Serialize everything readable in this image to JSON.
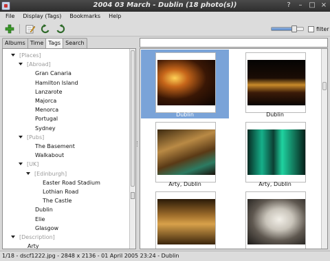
{
  "window": {
    "title": "2004 03 March - Dublin (18 photo(s))",
    "controls": [
      "?",
      "–",
      "□",
      "×"
    ]
  },
  "menu": [
    "File",
    "Display (Tags)",
    "Bookmarks",
    "Help"
  ],
  "toolbar": {
    "add_icon": "plus-icon",
    "edit_icon": "edit-icon",
    "rotate_left_icon": "rotate-left-icon",
    "rotate_right_icon": "rotate-right-icon",
    "zoom_level": 0.72,
    "filter_label": "filter",
    "filter_checked": false
  },
  "tabs": [
    "Albums",
    "Time",
    "Tags",
    "Search"
  ],
  "active_tab": "Tags",
  "tree": [
    {
      "label": "[Places]",
      "depth": 0,
      "expanded": true,
      "dim": true
    },
    {
      "label": "[Abroad]",
      "depth": 1,
      "expanded": true,
      "dim": true
    },
    {
      "label": "Gran Canaria",
      "depth": 2
    },
    {
      "label": "Hamilton Island",
      "depth": 2
    },
    {
      "label": "Lanzarote",
      "depth": 2
    },
    {
      "label": "Majorca",
      "depth": 2
    },
    {
      "label": "Menorca",
      "depth": 2
    },
    {
      "label": "Portugal",
      "depth": 2
    },
    {
      "label": "Sydney",
      "depth": 2
    },
    {
      "label": "[Pubs]",
      "depth": 1,
      "expanded": true,
      "dim": true
    },
    {
      "label": "The Basement",
      "depth": 2
    },
    {
      "label": "Walkabout",
      "depth": 2
    },
    {
      "label": "[UK]",
      "depth": 1,
      "expanded": true,
      "dim": true
    },
    {
      "label": "[Edinburgh]",
      "depth": 2,
      "expanded": true,
      "dim": true
    },
    {
      "label": "Easter Road Stadium",
      "depth": 3
    },
    {
      "label": "Lothian Road",
      "depth": 3
    },
    {
      "label": "The Castle",
      "depth": 3
    },
    {
      "label": "Dublin",
      "depth": 2
    },
    {
      "label": "Elie",
      "depth": 2
    },
    {
      "label": "Glasgow",
      "depth": 2
    },
    {
      "label": "[Description]",
      "depth": 0,
      "expanded": true,
      "dim": true
    },
    {
      "label": "Arty",
      "depth": 1
    }
  ],
  "thumbnails": [
    {
      "caption": "Dublin",
      "selected": true,
      "photo": "night pub lights"
    },
    {
      "caption": "Dublin",
      "selected": false,
      "photo": "night street"
    },
    {
      "caption": "Arty, Dublin",
      "selected": false,
      "photo": "bar interior"
    },
    {
      "caption": "Arty, Dublin",
      "selected": false,
      "photo": "green stained glass"
    },
    {
      "caption": "",
      "selected": false,
      "photo": "wooden railings"
    },
    {
      "caption": "",
      "selected": false,
      "photo": "plated dessert"
    }
  ],
  "status_bar": "1/18 - dscf1222.jpg - 2848 x 2136 - 01 April 2005 23:24 - Dublin",
  "colors": {
    "selection": "#7aa3d8",
    "titlebar": "#3a3a3a"
  }
}
